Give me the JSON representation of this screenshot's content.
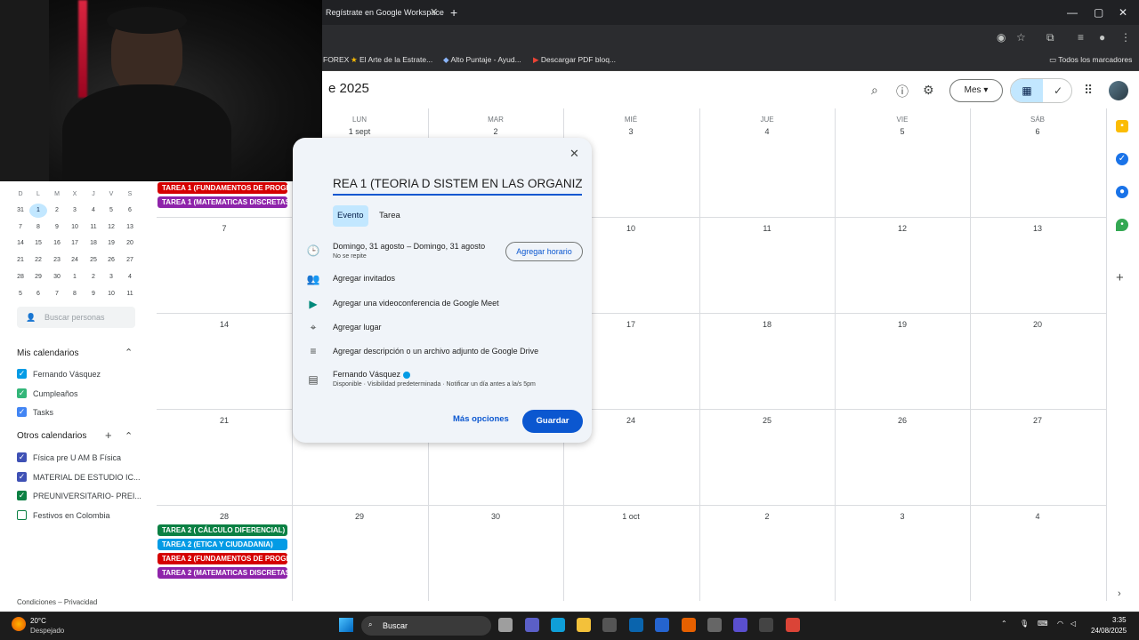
{
  "browser": {
    "tab_title": "Regístrate en Google Workspace",
    "tab_close": "✕",
    "new_tab": "+",
    "window_controls": [
      "—",
      "▢",
      "✕"
    ],
    "bookmarks": [
      "FOREX",
      "El Arte de la Estrate...",
      "Alto Puntaje - Ayud...",
      "Descargar PDF bloq..."
    ],
    "all_bookmarks": "Todos los marcadores"
  },
  "header": {
    "month_title": "e 2025",
    "view_select": "Mes",
    "view_select_caret": "▾"
  },
  "weekdays": [
    "LUN",
    "MAR",
    "MIÉ",
    "JUE",
    "VIE",
    "SÁB"
  ],
  "weeks": [
    [
      "1 sept",
      "2",
      "3",
      "4",
      "5",
      "6"
    ],
    [
      "7",
      "",
      "",
      "10",
      "11",
      "12",
      "13"
    ],
    [
      "14",
      "",
      "",
      "17",
      "18",
      "19",
      "20"
    ],
    [
      "21",
      "",
      "",
      "24",
      "25",
      "26",
      "27"
    ],
    [
      "28",
      "29",
      "30",
      "1 oct",
      "2",
      "3",
      "4"
    ]
  ],
  "events": {
    "week1": [
      "TAREA 1 (FUNDAMENTOS DE PROGR",
      "TAREA 1 (MATEMATICAS DISCRETAS"
    ],
    "week5": [
      "TAREA 2 ( CÁLCULO DIFERENCIAL)",
      "TAREA 2 (ETICA Y CIUDADANIA)",
      "TAREA 2 (FUNDAMENTOS DE PROGR",
      "TAREA 2 (MATEMATICAS DISCRETAS"
    ]
  },
  "event_colors": [
    "#d50000",
    "#8e24aa",
    "#0b8043",
    "#039be5",
    "#d50000",
    "#8e24aa"
  ],
  "mini_calendar": {
    "dow": [
      "D",
      "L",
      "M",
      "X",
      "J",
      "V",
      "S"
    ],
    "rows": [
      [
        "31",
        "1",
        "2",
        "3",
        "4",
        "5",
        "6"
      ],
      [
        "7",
        "8",
        "9",
        "10",
        "11",
        "12",
        "13"
      ],
      [
        "14",
        "15",
        "16",
        "17",
        "18",
        "19",
        "20"
      ],
      [
        "21",
        "22",
        "23",
        "24",
        "25",
        "26",
        "27"
      ],
      [
        "28",
        "29",
        "30",
        "1",
        "2",
        "3",
        "4"
      ],
      [
        "5",
        "6",
        "7",
        "8",
        "9",
        "10",
        "11"
      ]
    ]
  },
  "sidebar": {
    "search_people_placeholder": "Buscar personas",
    "my_calendars_title": "Mis calendarios",
    "my_calendars": [
      {
        "label": "Fernando Vásquez",
        "color": "#039be5",
        "checked": true
      },
      {
        "label": "Cumpleaños",
        "color": "#33b679",
        "checked": true
      },
      {
        "label": "Tasks",
        "color": "#4285f4",
        "checked": true
      }
    ],
    "other_calendars_title": "Otros calendarios",
    "other_calendars": [
      {
        "label": "Física pre U AM B Física",
        "color": "#3f51b5",
        "checked": true
      },
      {
        "label": "MATERIAL DE ESTUDIO IC...",
        "color": "#3f51b5",
        "checked": true
      },
      {
        "label": "PREUNIVERSITARIO- PREI...",
        "color": "#0b8043",
        "checked": true
      },
      {
        "label": "Festivos en Colombia",
        "color": "#0b8043",
        "checked": false
      }
    ],
    "footer": "Condiciones – Privacidad"
  },
  "popup": {
    "title_value": "REA 1 (TEORIA D SISTEM EN LAS ORGANIZ)",
    "tab_event": "Evento",
    "tab_task": "Tarea",
    "date_start": "Domingo, 31 agosto",
    "date_sep": "–",
    "date_end": "Domingo, 31 agosto",
    "repeat": "No se repite",
    "add_time": "Agregar horario",
    "add_guests": "Agregar invitados",
    "add_meet": "Agregar una videoconferencia de Google Meet",
    "add_location": "Agregar lugar",
    "add_description": "Agregar descripción o un archivo adjunto de Google Drive",
    "owner": "Fernando Vásquez",
    "owner_details": "Disponible · Visibilidad predeterminada · Notificar un día antes a la/s 5pm",
    "more_options": "Más opciones",
    "save": "Guardar"
  },
  "taskbar": {
    "weather_temp": "20°C",
    "weather_desc": "Despejado",
    "search_label": "Buscar",
    "time": "3:35",
    "date": "24/08/2025"
  },
  "colors": {
    "accent": "#0b57d0",
    "today_bg": "#c2e7ff"
  }
}
